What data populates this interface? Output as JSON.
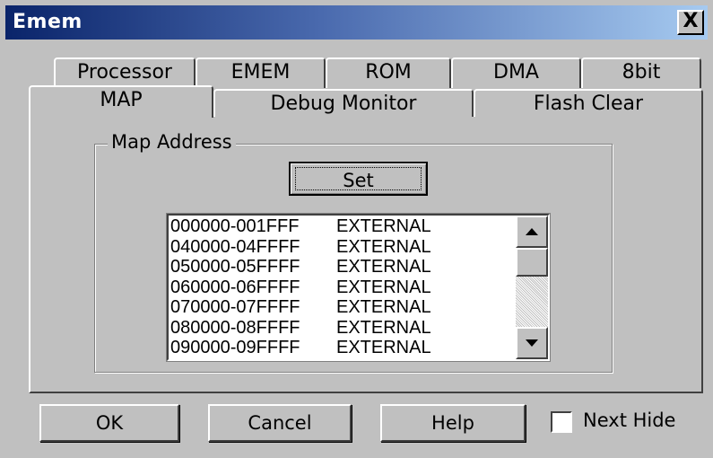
{
  "window": {
    "title": "Emem",
    "close_label": "X"
  },
  "tabs_back": [
    "Processor",
    "EMEM",
    "ROM",
    "DMA",
    "8bit"
  ],
  "tabs_front": [
    "MAP",
    "Debug Monitor",
    "Flash Clear"
  ],
  "selected_tab": "MAP",
  "group": {
    "label": "Map Address"
  },
  "set_button": "Set",
  "map_list": [
    {
      "range": "000000-001FFF",
      "type": "EXTERNAL"
    },
    {
      "range": "040000-04FFFF",
      "type": "EXTERNAL"
    },
    {
      "range": "050000-05FFFF",
      "type": "EXTERNAL"
    },
    {
      "range": "060000-06FFFF",
      "type": "EXTERNAL"
    },
    {
      "range": "070000-07FFFF",
      "type": "EXTERNAL"
    },
    {
      "range": "080000-08FFFF",
      "type": "EXTERNAL"
    },
    {
      "range": "090000-09FFFF",
      "type": "EXTERNAL"
    }
  ],
  "buttons": {
    "ok": "OK",
    "cancel": "Cancel",
    "help": "Help"
  },
  "next_hide": {
    "label": "Next Hide",
    "checked": false
  },
  "icons": {
    "scroll_up": "arrow-up-icon",
    "scroll_down": "arrow-down-icon",
    "close": "close-icon"
  }
}
